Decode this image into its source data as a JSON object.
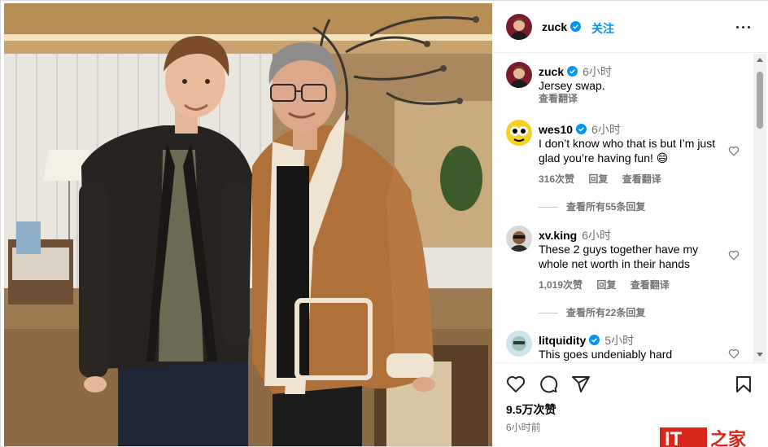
{
  "post": {
    "author": "zuck",
    "follow_label": "关注",
    "caption": {
      "user": "zuck",
      "time": "6小时",
      "text": "Jersey swap.",
      "translate_label": "查看翻译"
    },
    "comments": [
      {
        "user": "wes10",
        "verified": true,
        "time": "6小时",
        "text": "I don’t know who that is but I’m just glad you’re having fun! 😄",
        "likes": "316次赞",
        "reply_label": "回复",
        "translate_label": "查看翻译",
        "view_replies": "查看所有55条回复"
      },
      {
        "user": "xv.king",
        "verified": false,
        "time": "6小时",
        "text": "These 2 guys together have my whole net worth in their hands",
        "likes": "1,019次赞",
        "reply_label": "回复",
        "translate_label": "查看翻译",
        "view_replies": "查看所有22条回复"
      },
      {
        "user": "litquidity",
        "verified": true,
        "time": "5小时",
        "text": "This goes undeniably hard"
      }
    ],
    "like_count": "9.5万次赞",
    "posted_ago": "6小时前"
  },
  "icons": {
    "verified": "verified-badge-icon",
    "more": "more-options-icon",
    "like": "heart-icon",
    "comment": "comment-icon",
    "share": "share-icon",
    "save": "bookmark-icon"
  },
  "colors": {
    "accent": "#0095f6",
    "verified": "#0095f6",
    "muted": "#737373",
    "watermark": "#d9261c"
  },
  "watermark": {
    "text_a": "IT",
    "text_b": "之家"
  }
}
